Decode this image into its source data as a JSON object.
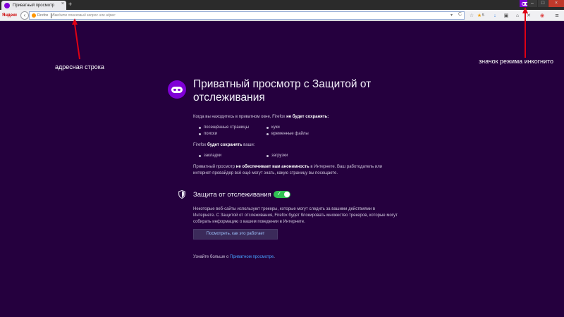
{
  "tab": {
    "title": "Приватный просмотр",
    "close": "×",
    "new_tab": "+"
  },
  "window": {
    "minimize": "–",
    "maximize": "□",
    "close": "×"
  },
  "toolbar": {
    "brand": "Яндекс",
    "back": "‹",
    "identity": "Firefox",
    "url_placeholder": "Введите поисковый запрос или адрес",
    "dropdown": "▾",
    "reload": "C",
    "icons": [
      "bookmark-icon",
      "star-icon",
      "download-icon",
      "reader-icon",
      "home-icon",
      "close-icon",
      "pocket-icon",
      "menu-icon"
    ],
    "count": "5"
  },
  "annotations": {
    "address_bar": "адресная строка",
    "private_icon": "значок режима инкогнито"
  },
  "page": {
    "heading": "Приватный просмотр с Защитой от отслеживания",
    "intro_pre": "Когда вы находитесь в приватном окне, Firefox ",
    "intro_bold": "не будет сохранять:",
    "not_saved": [
      "посещённые страницы",
      "поиски",
      "куки",
      "временные файлы"
    ],
    "saved_pre": "Firefox ",
    "saved_bold": "будет сохранять",
    "saved_post": " ваши:",
    "saved": [
      "закладки",
      "загрузки"
    ],
    "warning_pre": "Приватный просмотр ",
    "warning_bold": "не обеспечивает вам анонимность",
    "warning_post": " в Интернете. Ваш работодатель или интернет-провайдер всё ещё могут знать, какую страницу вы посещаете.",
    "tp_title": "Защита от отслеживания",
    "tp_toggle_state": "on",
    "tp_check": "✓",
    "tp_text": "Некоторые веб-сайты используют трекеры, которые могут следить за вашими действиями в Интернете. С Защитой от отслеживания, Firefox будет блокировать множество трекеров, которые могут собирать информацию о вашем поведении в Интернете.",
    "tp_button": "Посмотреть, как это работает",
    "learn_pre": "Узнайте больше о ",
    "learn_link": "Приватном просмотре",
    "learn_post": "."
  },
  "colors": {
    "background": "#25003e",
    "accent": "#8000d7",
    "toggle_on": "#30c053",
    "annotation": "#e00014",
    "link": "#45a1ff"
  }
}
